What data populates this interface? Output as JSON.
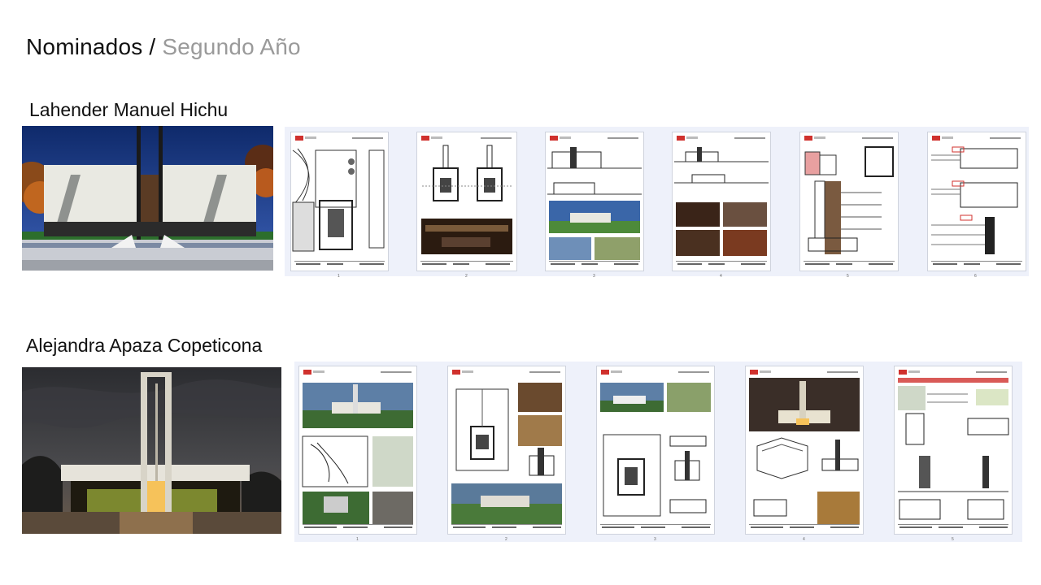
{
  "header": {
    "title_main": "Nominados",
    "separator": " / ",
    "title_sub": "Segundo Año"
  },
  "nominees": [
    {
      "name": "Lahender Manuel Hichu",
      "pages": [
        "1",
        "2",
        "3",
        "4",
        "5",
        "6"
      ]
    },
    {
      "name": "Alejandra Apaza Copeticona",
      "pages": [
        "1",
        "2",
        "3",
        "4",
        "5"
      ]
    }
  ],
  "colors": {
    "subtitle": "#9a9a9a",
    "strip": "#eef1fa",
    "accent": "#d0312d"
  }
}
